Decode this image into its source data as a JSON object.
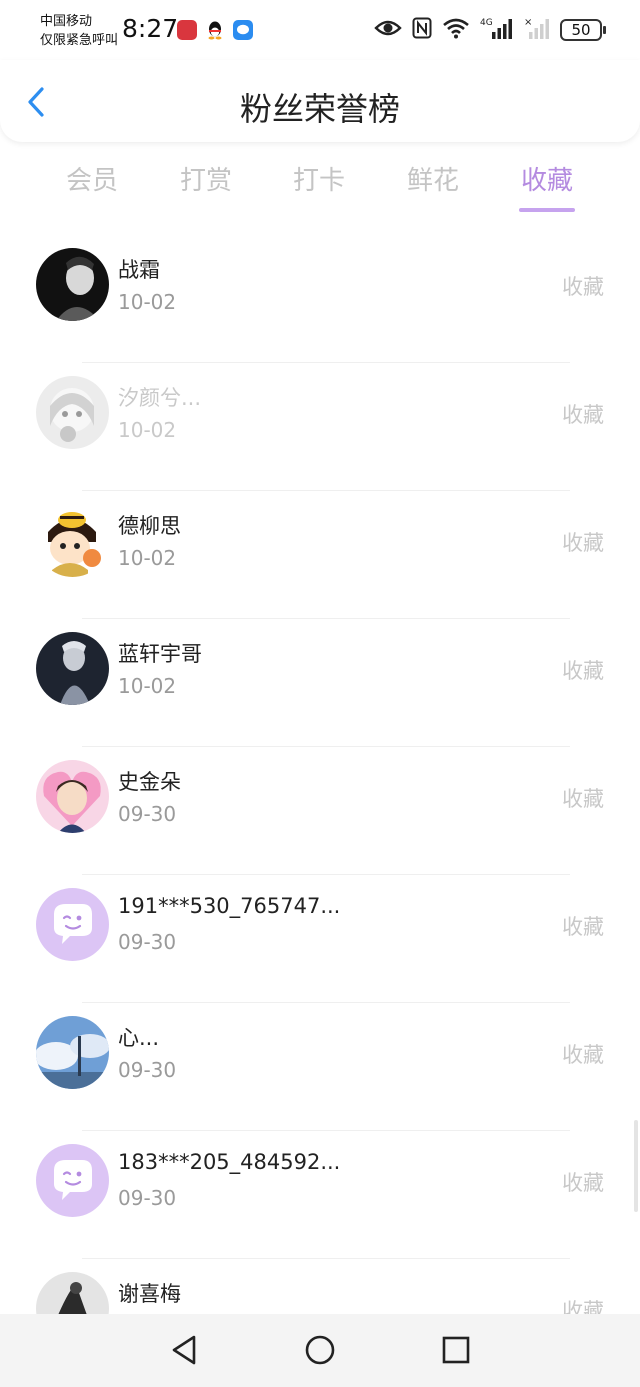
{
  "status_bar": {
    "carrier_line1": "中国移动",
    "carrier_line2": "仅限紧急呼叫",
    "time": "8:27",
    "battery": "50",
    "network": "4G"
  },
  "header": {
    "title": "粉丝荣誉榜"
  },
  "tabs": [
    {
      "label": "会员",
      "active": false
    },
    {
      "label": "打赏",
      "active": false
    },
    {
      "label": "打卡",
      "active": false
    },
    {
      "label": "鲜花",
      "active": false
    },
    {
      "label": "收藏",
      "active": true
    }
  ],
  "colors": {
    "accent": "#b48be0",
    "tab_inactive": "#c4c4c4",
    "date_text": "#9a9a9a"
  },
  "fans": [
    {
      "name": "战霜",
      "date": "10-02",
      "action": "收藏",
      "avatar": "dark-portrait"
    },
    {
      "name": "汐颜兮...",
      "date": "10-02",
      "action": "收藏",
      "avatar": "anime-grey"
    },
    {
      "name": "德柳思",
      "date": "10-02",
      "action": "收藏",
      "avatar": "bee-cartoon"
    },
    {
      "name": "蓝轩宇哥",
      "date": "10-02",
      "action": "收藏",
      "avatar": "dark-figure"
    },
    {
      "name": "史金朵",
      "date": "09-30",
      "action": "收藏",
      "avatar": "pink-heart-photo"
    },
    {
      "name": "191***530_765747...",
      "date": "09-30",
      "action": "收藏",
      "avatar": "default-purple-chat"
    },
    {
      "name": "心...",
      "date": "09-30",
      "action": "收藏",
      "avatar": "sky-clouds"
    },
    {
      "name": "183***205_484592...",
      "date": "09-30",
      "action": "收藏",
      "avatar": "default-purple-chat"
    },
    {
      "name": "谢喜梅",
      "date": "",
      "action": "收藏",
      "avatar": "ink-figure"
    }
  ],
  "nav": {
    "back": "back-triangle-icon",
    "home": "home-circle-icon",
    "recents": "recents-square-icon"
  }
}
